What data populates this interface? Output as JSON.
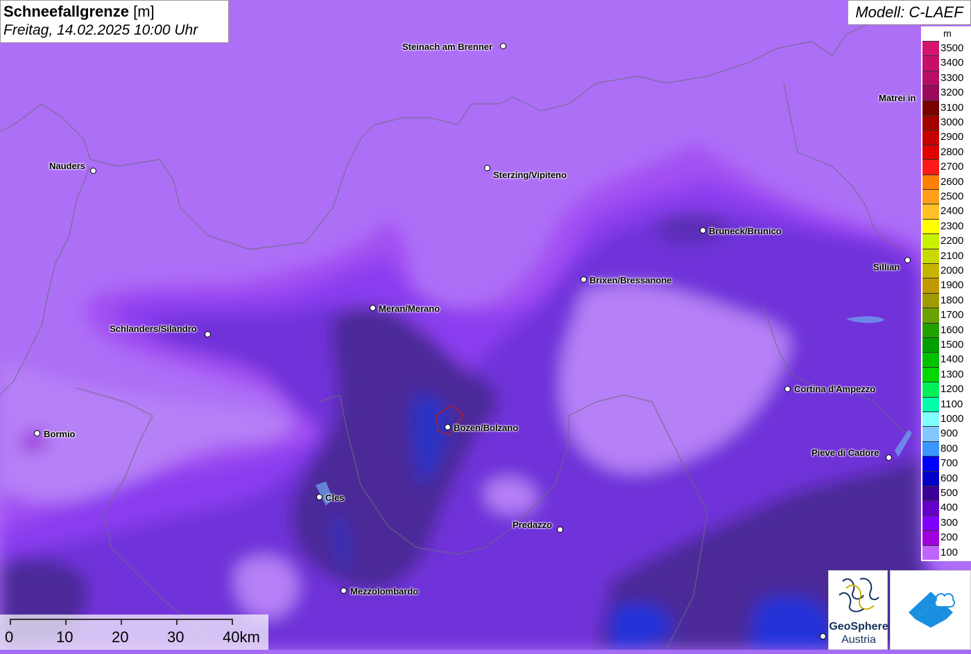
{
  "title": {
    "main_bold": "Schneefallgrenze",
    "main_unit": "[m]",
    "date": "Freitag, 14.02.2025 10:00 Uhr"
  },
  "model": "Modell: C-LAEF",
  "legend": {
    "unit": "m",
    "entries": [
      {
        "label": "3500",
        "color": "#d4146e"
      },
      {
        "label": "3400",
        "color": "#c80f68"
      },
      {
        "label": "3300",
        "color": "#b80c66"
      },
      {
        "label": "3200",
        "color": "#9a0a5a"
      },
      {
        "label": "3100",
        "color": "#7a0000"
      },
      {
        "label": "3000",
        "color": "#a40000"
      },
      {
        "label": "2900",
        "color": "#c40000"
      },
      {
        "label": "2800",
        "color": "#e00000"
      },
      {
        "label": "2700",
        "color": "#ff1a1a"
      },
      {
        "label": "2600",
        "color": "#ff7f00"
      },
      {
        "label": "2500",
        "color": "#ff9f1a"
      },
      {
        "label": "2400",
        "color": "#ffbf26"
      },
      {
        "label": "2300",
        "color": "#ffff00"
      },
      {
        "label": "2200",
        "color": "#c8f000"
      },
      {
        "label": "2100",
        "color": "#c8d800"
      },
      {
        "label": "2000",
        "color": "#c8b400"
      },
      {
        "label": "1900",
        "color": "#c09a00"
      },
      {
        "label": "1800",
        "color": "#a09a00"
      },
      {
        "label": "1700",
        "color": "#6aa000"
      },
      {
        "label": "1600",
        "color": "#22a000"
      },
      {
        "label": "1500",
        "color": "#00a000"
      },
      {
        "label": "1400",
        "color": "#00c000"
      },
      {
        "label": "1300",
        "color": "#00d800"
      },
      {
        "label": "1200",
        "color": "#00f05a"
      },
      {
        "label": "1100",
        "color": "#00ffaa"
      },
      {
        "label": "1000",
        "color": "#80ffff"
      },
      {
        "label": "900",
        "color": "#80c8ff"
      },
      {
        "label": "800",
        "color": "#3c96ff"
      },
      {
        "label": "700",
        "color": "#0000ff"
      },
      {
        "label": "600",
        "color": "#0000c8"
      },
      {
        "label": "500",
        "color": "#3c0096"
      },
      {
        "label": "400",
        "color": "#6400c8"
      },
      {
        "label": "300",
        "color": "#8000ff"
      },
      {
        "label": "200",
        "color": "#a000dc"
      },
      {
        "label": "100",
        "color": "#c064ff"
      }
    ]
  },
  "scale": {
    "labels": [
      "0",
      "10",
      "20",
      "30",
      "40km"
    ]
  },
  "cities": [
    {
      "name": "Steinach am Brenner"
    },
    {
      "name": "Nauders"
    },
    {
      "name": "Sterzing/Vipiteno"
    },
    {
      "name": "Matrei in"
    },
    {
      "name": "Bruneck/Brunico"
    },
    {
      "name": "Sillian"
    },
    {
      "name": "Brixen/Bressanone"
    },
    {
      "name": "Meran/Merano"
    },
    {
      "name": "Schlanders/Silandro"
    },
    {
      "name": "Cortina d'Ampezzo"
    },
    {
      "name": "Bormio"
    },
    {
      "name": "Bozen/Bolzano"
    },
    {
      "name": "Pieve di Cadore"
    },
    {
      "name": "Cles"
    },
    {
      "name": "Predazzo"
    },
    {
      "name": "Mezzolombardo"
    }
  ],
  "logos": {
    "geosphere_line1": "GeoSphere",
    "geosphere_line2": "Austria"
  },
  "colors": {
    "band_100": "#b07df7",
    "band_200": "#a354f5",
    "band_300": "#8a3ff0",
    "band_400": "#6a2fd0",
    "band_500": "#4a2a9a",
    "band_700": "#2a30c0"
  }
}
